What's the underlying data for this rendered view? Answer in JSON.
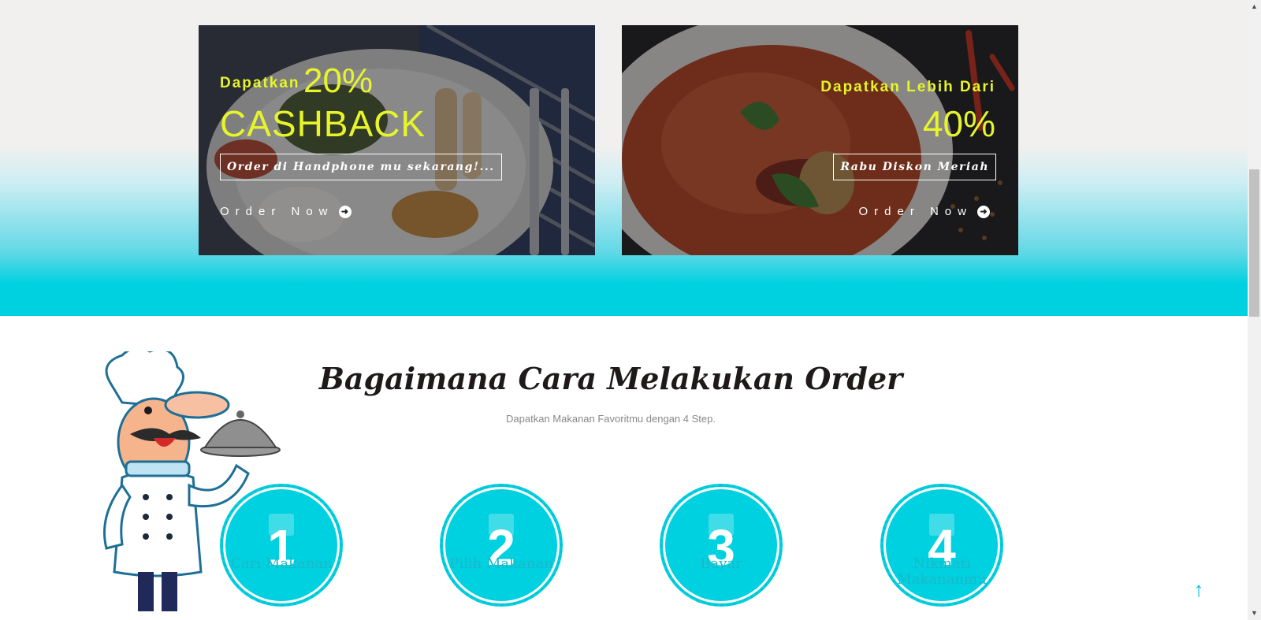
{
  "promos": {
    "left": {
      "line1_small": "Dapatkan",
      "line1_big": "20%",
      "line2": "CASHBACK",
      "box_text": "Order di Handphone mu sekarang!...",
      "cta": "Order Now"
    },
    "right": {
      "line1": "Dapatkan Lebih Dari",
      "line2": "40%",
      "box_text": "Rabu Diskon Meriah",
      "cta": "Order Now"
    },
    "accent_color": "#e6f52a"
  },
  "how": {
    "title": "Bagaimana Cara Melakukan Order",
    "subtitle": "Dapatkan Makanan Favoritmu dengan 4 Step.",
    "steps": [
      {
        "num": "1",
        "label": "Cari Makanan",
        "icon": "map-icon"
      },
      {
        "num": "2",
        "label": "Pilih Makanan",
        "icon": "utensils-icon"
      },
      {
        "num": "3",
        "label": "Bayar",
        "icon": "card-icon"
      },
      {
        "num": "4",
        "label": "Nikmati Makananmu",
        "icon": "food-icon"
      }
    ],
    "step_color": "#00d1e0"
  },
  "back_to_top_icon": "arrow-up-icon"
}
